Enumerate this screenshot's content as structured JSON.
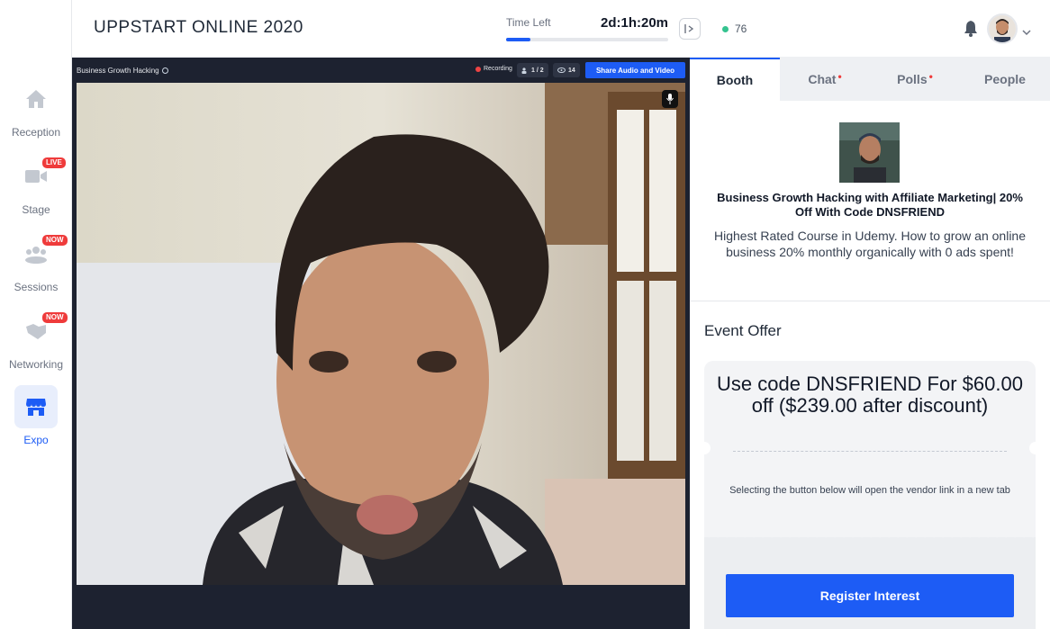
{
  "nav": {
    "items": [
      {
        "label": "Reception",
        "icon": "home-icon"
      },
      {
        "label": "Stage",
        "icon": "video-camera-icon",
        "badge": "LIVE"
      },
      {
        "label": "Sessions",
        "icon": "people-group-icon",
        "badge": "NOW"
      },
      {
        "label": "Networking",
        "icon": "handshake-icon",
        "badge": "NOW"
      },
      {
        "label": "Expo",
        "icon": "storefront-icon",
        "active": true
      }
    ]
  },
  "header": {
    "title": "UPPSTART ONLINE 2020",
    "time_left_label": "Time Left",
    "time_left_value": "2d:1h:20m",
    "time_progress": 0.15,
    "online_count": "76"
  },
  "video": {
    "session_name": "Business Growth Hacking",
    "recording_label": "Recording",
    "speakers": "1 / 2",
    "viewers": "14",
    "share_button": "Share Audio and Video"
  },
  "panel": {
    "tabs": [
      {
        "label": "Booth",
        "active": true,
        "dot": false
      },
      {
        "label": "Chat",
        "active": false,
        "dot": true
      },
      {
        "label": "Polls",
        "active": false,
        "dot": true
      },
      {
        "label": "People",
        "active": false,
        "dot": false
      }
    ],
    "booth": {
      "title": "Business Growth Hacking with Affiliate Marketing| 20% Off With Code DNSFRIEND",
      "description": "Highest Rated Course in Udemy. How to grow an online business 20% monthly organically with 0 ads spent!"
    },
    "offer": {
      "heading": "Event Offer",
      "headline": "Use code DNSFRIEND For $60.00 off ($239.00 after discount)",
      "note": "Selecting the button below will open the vendor link in a new tab",
      "button": "Register Interest"
    }
  },
  "colors": {
    "accent": "#1d5cf5",
    "badge": "#ef3b3b",
    "online": "#34c38f",
    "video_bg": "#1d2230"
  }
}
